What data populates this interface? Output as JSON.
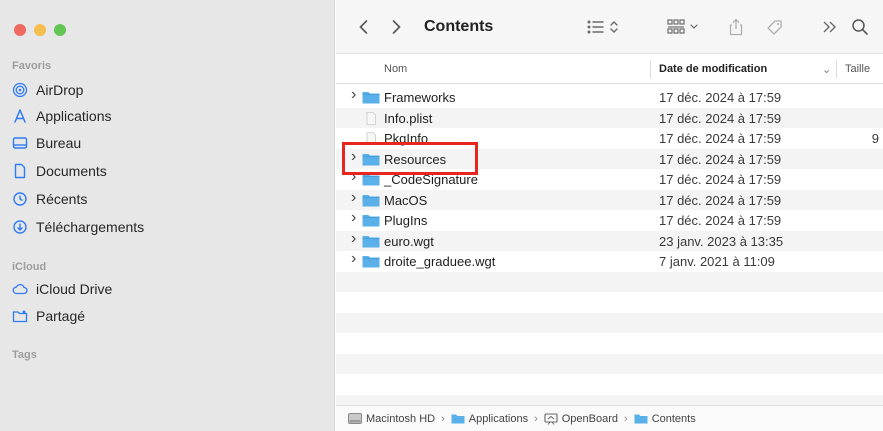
{
  "sidebar": {
    "sections": [
      {
        "title": "Favoris",
        "items": [
          {
            "label": "AirDrop",
            "icon": "airdrop-icon"
          },
          {
            "label": "Applications",
            "icon": "applications-icon"
          },
          {
            "label": "Bureau",
            "icon": "desktop-icon"
          },
          {
            "label": "Documents",
            "icon": "document-icon"
          },
          {
            "label": "Récents",
            "icon": "clock-icon"
          },
          {
            "label": "Téléchargements",
            "icon": "download-icon"
          }
        ]
      },
      {
        "title": "iCloud",
        "items": [
          {
            "label": "iCloud Drive",
            "icon": "cloud-icon"
          },
          {
            "label": "Partagé",
            "icon": "shared-folder-icon"
          }
        ]
      },
      {
        "title": "Tags",
        "items": []
      }
    ]
  },
  "toolbar": {
    "title": "Contents"
  },
  "columns": {
    "name": "Nom",
    "date": "Date de modification",
    "size": "Taille"
  },
  "files": [
    {
      "name": "Frameworks",
      "date": "17 déc. 2024 à 17:59",
      "size": "",
      "type": "folder",
      "expandable": true
    },
    {
      "name": "Info.plist",
      "date": "17 déc. 2024 à 17:59",
      "size": "",
      "type": "file",
      "expandable": false
    },
    {
      "name": "PkgInfo",
      "date": "17 déc. 2024 à 17:59",
      "size": "9",
      "type": "file",
      "expandable": false
    },
    {
      "name": "Resources",
      "date": "17 déc. 2024 à 17:59",
      "size": "",
      "type": "folder",
      "expandable": true
    },
    {
      "name": "_CodeSignature",
      "date": "17 déc. 2024 à 17:59",
      "size": "",
      "type": "folder",
      "expandable": true
    },
    {
      "name": "MacOS",
      "date": "17 déc. 2024 à 17:59",
      "size": "",
      "type": "folder",
      "expandable": true
    },
    {
      "name": "PlugIns",
      "date": "17 déc. 2024 à 17:59",
      "size": "",
      "type": "folder",
      "expandable": true
    },
    {
      "name": "euro.wgt",
      "date": "23 janv. 2023 à 13:35",
      "size": "",
      "type": "folder",
      "expandable": true
    },
    {
      "name": "droite_graduee.wgt",
      "date": "7 janv. 2021 à 11:09",
      "size": "",
      "type": "folder",
      "expandable": true
    }
  ],
  "pathbar": [
    {
      "label": "Macintosh HD",
      "icon": "hard-drive-icon"
    },
    {
      "label": "Applications",
      "icon": "folder-icon"
    },
    {
      "label": "OpenBoard",
      "icon": "app-icon"
    },
    {
      "label": "Contents",
      "icon": "folder-icon"
    }
  ],
  "colors": {
    "folder": "#5ab0e8",
    "highlight": "#e6261f",
    "sidebar_bg": "#e8e7e7"
  }
}
